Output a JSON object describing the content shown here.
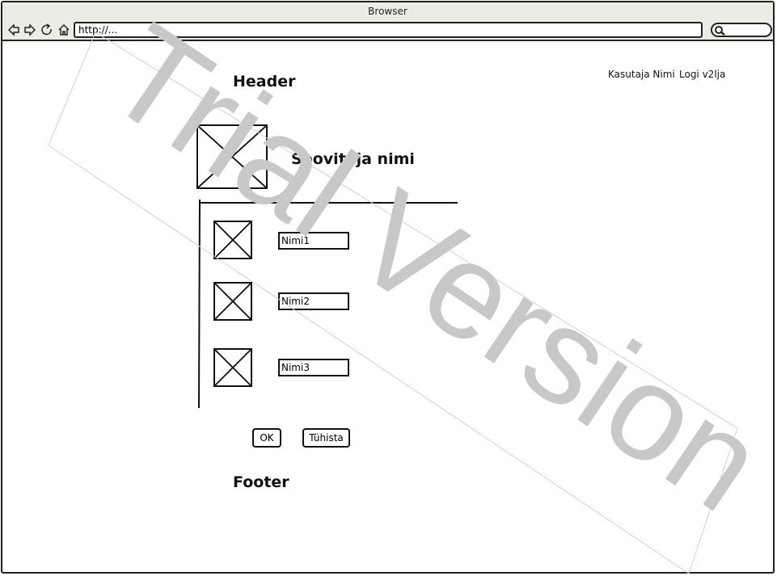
{
  "window": {
    "title": "Browser"
  },
  "toolbar": {
    "url": "http://...",
    "icons": [
      "back-arrow-icon",
      "forward-arrow-icon",
      "reload-icon",
      "home-icon",
      "search-icon"
    ]
  },
  "page": {
    "header": "Header",
    "user_name": "Kasutaja Nimi",
    "logout": "Logi v2lja",
    "recommender_name": "Soovitaja nimi",
    "items": [
      {
        "name": "Nimi1"
      },
      {
        "name": "Nimi2"
      },
      {
        "name": "Nimi3"
      }
    ],
    "ok_label": "OK",
    "cancel_label": "Tühista",
    "footer": "Footer"
  },
  "watermark": {
    "text": "Trial Version"
  }
}
